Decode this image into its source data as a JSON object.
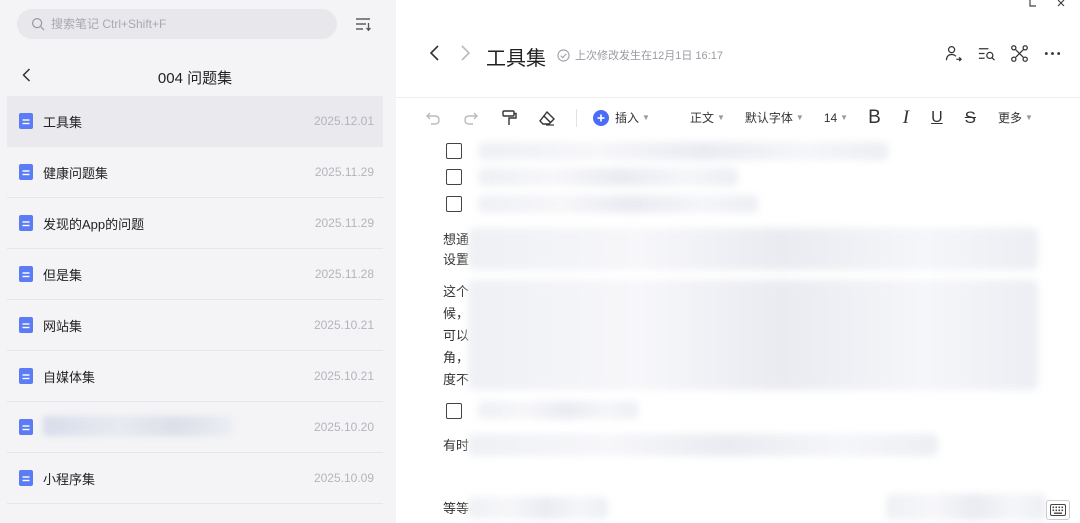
{
  "search": {
    "placeholder": "搜索笔记 Ctrl+Shift+F"
  },
  "folder": {
    "title": "004 问题集"
  },
  "notes": [
    {
      "title": "工具集",
      "date": "2025.12.01"
    },
    {
      "title": "健康问题集",
      "date": "2025.11.29"
    },
    {
      "title": "发现的App的问题",
      "date": "2025.11.29"
    },
    {
      "title": "但是集",
      "date": "2025.11.28"
    },
    {
      "title": "网站集",
      "date": "2025.10.21"
    },
    {
      "title": "自媒体集",
      "date": "2025.10.21"
    },
    {
      "title": "",
      "date": "2025.10.20"
    },
    {
      "title": "小程序集",
      "date": "2025.10.09"
    }
  ],
  "document": {
    "title": "工具集",
    "modified": "上次修改发生在12月1日 16:17"
  },
  "toolbar": {
    "insert": "插入",
    "paragraph_style": "正文",
    "font": "默认字体",
    "font_size": "14",
    "bold": "B",
    "italic": "I",
    "underline": "U",
    "strike": "S",
    "more": "更多"
  },
  "content": {
    "lines": [
      "想通",
      "设置",
      "这个",
      "候，",
      "可以",
      "角，",
      "度不",
      "有时",
      "等等"
    ]
  },
  "colors": {
    "accent": "#4a6cf7",
    "doc_icon": "#5b7cf5"
  }
}
